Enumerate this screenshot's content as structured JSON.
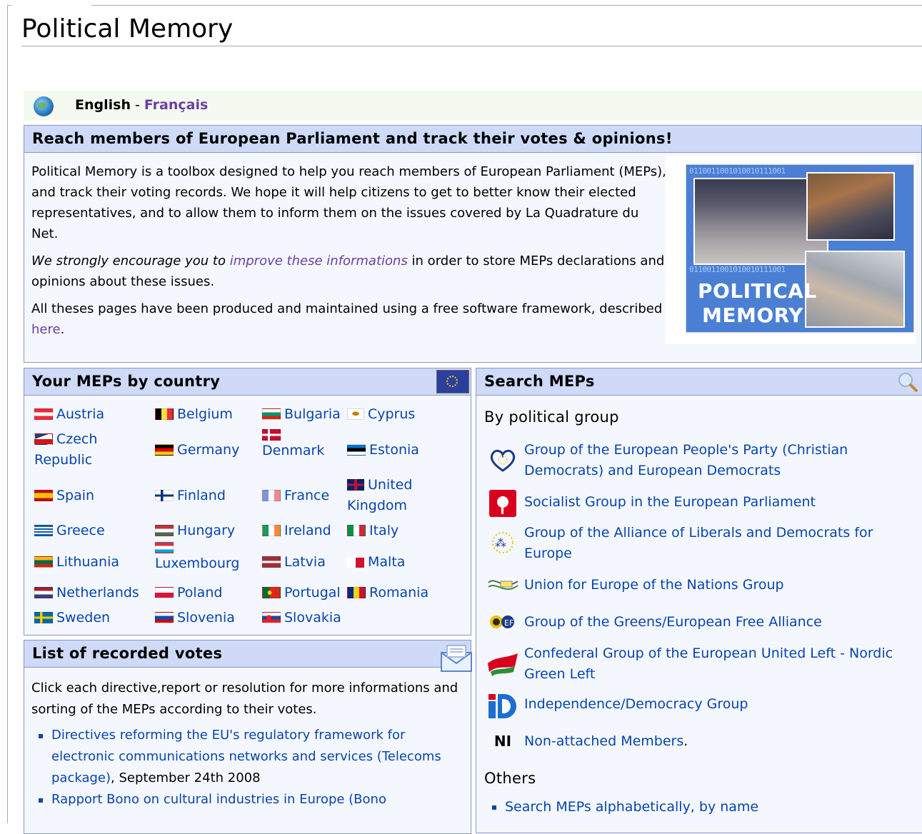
{
  "page": {
    "title": "Political Memory"
  },
  "lang": {
    "current": "English",
    "separator": " - ",
    "other": "Français"
  },
  "intro": {
    "heading": "Reach members of European Parliament and track their votes & opinions!",
    "p1": "Political Memory is a toolbox designed to help you reach members of European Parliament (MEPs), and track their voting records. We hope it will help citizens to get to better know their elected representatives, and to allow them to inform them on the issues covered by La Quadrature du Net.",
    "p2_prefix": "We strongly encourage you to ",
    "p2_link": "improve these informations",
    "p2_suffix": " in order to store MEPs declarations and opinions about these issues.",
    "p3_prefix": "All theses pages have been produced and maintained using a free software framework, described ",
    "p3_link": "here",
    "p3_suffix": ".",
    "logo_line1": "POLITICAL",
    "logo_line2": "MEMORY",
    "logo_binary": "0110011001010010111001"
  },
  "countries": {
    "heading": "Your MEPs by country",
    "items": [
      "Austria",
      "Belgium",
      "Bulgaria",
      "Cyprus",
      "Czech Republic",
      "Germany",
      "Denmark",
      "Estonia",
      "Spain",
      "Finland",
      "France",
      "United Kingdom",
      "Greece",
      "Hungary",
      "Ireland",
      "Italy",
      "Lithuania",
      "Luxembourg",
      "Latvia",
      "Malta",
      "Netherlands",
      "Poland",
      "Portugal",
      "Romania",
      "Sweden",
      "Slovenia",
      "Slovakia"
    ]
  },
  "votes": {
    "heading": "List of recorded votes",
    "intro": "Click each directive,report or resolution for more informations and sorting of the MEPs according to their votes.",
    "items": [
      {
        "link": "Directives reforming the EU's regulatory framework for electronic communications networks and services (Telecoms package)",
        "suffix": ", September 24th 2008"
      },
      {
        "link": "Rapport Bono on cultural industries in Europe (Bono",
        "suffix": ""
      }
    ]
  },
  "search": {
    "heading": "Search MEPs",
    "by_group": "By political group",
    "groups": [
      {
        "label": "Group of the European People's Party (Christian Democrats) and European Democrats",
        "logo": "epp-heart-icon"
      },
      {
        "label": "Socialist Group in the European Parliament",
        "logo": "pes-rose-icon"
      },
      {
        "label": "Group of the Alliance of Liberals and Democrats for Europe",
        "logo": "alde-stars-icon"
      },
      {
        "label": "Union for Europe of the Nations Group",
        "logo": "uen-swirl-icon"
      },
      {
        "label": "Group of the Greens/European Free Alliance",
        "logo": "greens-sunflower-icon"
      },
      {
        "label": "Confederal Group of the European United Left - Nordic Green Left",
        "logo": "gue-flag-icon"
      },
      {
        "label": "Independence/Democracy Group",
        "logo": "ind-dem-logo-icon"
      },
      {
        "label": "Non-attached Members",
        "suffix": ".",
        "logo_text": "NI"
      }
    ],
    "others_heading": "Others",
    "others": [
      "Search MEPs alphabetically, by name"
    ]
  },
  "colors": {
    "link": "#0645ad",
    "visited": "#6b3fa0",
    "box_head": "#cedaf7",
    "box_border": "#8898bf"
  }
}
